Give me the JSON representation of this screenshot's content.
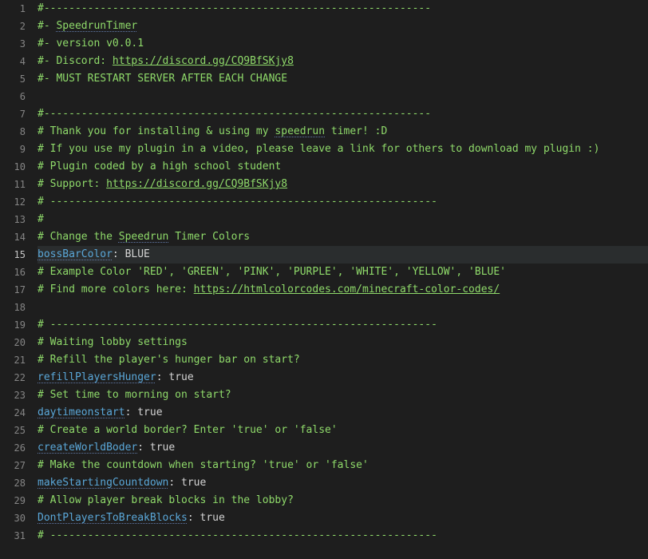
{
  "lines": [
    {
      "n": 1,
      "segs": [
        {
          "c": "comment",
          "t": "#--------------------------------------------------------------"
        }
      ]
    },
    {
      "n": 2,
      "segs": [
        {
          "c": "comment",
          "t": "#- "
        },
        {
          "c": "comment squiggle",
          "t": "SpeedrunTimer"
        }
      ]
    },
    {
      "n": 3,
      "segs": [
        {
          "c": "comment",
          "t": "#- version v0.0.1"
        }
      ]
    },
    {
      "n": 4,
      "segs": [
        {
          "c": "comment",
          "t": "#- Discord: "
        },
        {
          "c": "link",
          "t": "https://discord.gg/CQ9BfSKjy8"
        }
      ]
    },
    {
      "n": 5,
      "segs": [
        {
          "c": "comment",
          "t": "#- MUST RESTART SERVER AFTER EACH CHANGE"
        }
      ]
    },
    {
      "n": 6,
      "segs": []
    },
    {
      "n": 7,
      "segs": [
        {
          "c": "comment",
          "t": "#--------------------------------------------------------------"
        }
      ]
    },
    {
      "n": 8,
      "segs": [
        {
          "c": "comment",
          "t": "# Thank you for installing & using my "
        },
        {
          "c": "comment squiggle",
          "t": "speedrun"
        },
        {
          "c": "comment",
          "t": " timer! :D"
        }
      ]
    },
    {
      "n": 9,
      "segs": [
        {
          "c": "comment",
          "t": "# If you use my plugin in a video, please leave a link for others to download my plugin :)"
        }
      ]
    },
    {
      "n": 10,
      "segs": [
        {
          "c": "comment",
          "t": "# Plugin coded by a high school student"
        }
      ]
    },
    {
      "n": 11,
      "segs": [
        {
          "c": "comment",
          "t": "# Support: "
        },
        {
          "c": "link",
          "t": "https://discord.gg/CQ9BfSKjy8"
        }
      ]
    },
    {
      "n": 12,
      "segs": [
        {
          "c": "comment",
          "t": "# --------------------------------------------------------------"
        }
      ]
    },
    {
      "n": 13,
      "segs": [
        {
          "c": "comment",
          "t": "#"
        }
      ]
    },
    {
      "n": 14,
      "segs": [
        {
          "c": "comment",
          "t": "# Change the "
        },
        {
          "c": "comment squiggle",
          "t": "Speedrun"
        },
        {
          "c": "comment",
          "t": " Timer Colors"
        }
      ]
    },
    {
      "n": 15,
      "current": true,
      "segs": [
        {
          "c": "key squiggle",
          "t": "bossBarColor"
        },
        {
          "c": "value",
          "t": ": BLUE"
        }
      ]
    },
    {
      "n": 16,
      "segs": [
        {
          "c": "comment",
          "t": "# Example Color 'RED', 'GREEN', 'PINK', 'PURPLE', 'WHITE', 'YELLOW', 'BLUE'"
        }
      ]
    },
    {
      "n": 17,
      "segs": [
        {
          "c": "comment",
          "t": "# Find more colors here: "
        },
        {
          "c": "link",
          "t": "https://htmlcolorcodes.com/minecraft-color-codes/"
        }
      ]
    },
    {
      "n": 18,
      "segs": []
    },
    {
      "n": 19,
      "segs": [
        {
          "c": "comment",
          "t": "# --------------------------------------------------------------"
        }
      ]
    },
    {
      "n": 20,
      "segs": [
        {
          "c": "comment",
          "t": "# Waiting lobby settings"
        }
      ]
    },
    {
      "n": 21,
      "segs": [
        {
          "c": "comment",
          "t": "# Refill the player's hunger bar on start?"
        }
      ]
    },
    {
      "n": 22,
      "segs": [
        {
          "c": "key squiggle",
          "t": "refillPlayersHunger"
        },
        {
          "c": "value",
          "t": ": true"
        }
      ]
    },
    {
      "n": 23,
      "segs": [
        {
          "c": "comment",
          "t": "# Set time to morning on start?"
        }
      ]
    },
    {
      "n": 24,
      "segs": [
        {
          "c": "key squiggle",
          "t": "daytimeonstart"
        },
        {
          "c": "value",
          "t": ": true"
        }
      ]
    },
    {
      "n": 25,
      "segs": [
        {
          "c": "comment",
          "t": "# Create a world border? Enter 'true' or 'false'"
        }
      ]
    },
    {
      "n": 26,
      "segs": [
        {
          "c": "key squiggle",
          "t": "createWorldBoder"
        },
        {
          "c": "value",
          "t": ": true"
        }
      ]
    },
    {
      "n": 27,
      "segs": [
        {
          "c": "comment",
          "t": "# Make the countdown when starting? 'true' or 'false'"
        }
      ]
    },
    {
      "n": 28,
      "segs": [
        {
          "c": "key squiggle",
          "t": "makeStartingCountdown"
        },
        {
          "c": "value",
          "t": ": true"
        }
      ]
    },
    {
      "n": 29,
      "segs": [
        {
          "c": "comment",
          "t": "# Allow player break blocks in the lobby?"
        }
      ]
    },
    {
      "n": 30,
      "segs": [
        {
          "c": "key squiggle",
          "t": "DontPlayersToBreakBlocks"
        },
        {
          "c": "value",
          "t": ": true"
        }
      ]
    },
    {
      "n": 31,
      "segs": [
        {
          "c": "comment",
          "t": "# --------------------------------------------------------------"
        }
      ]
    }
  ]
}
